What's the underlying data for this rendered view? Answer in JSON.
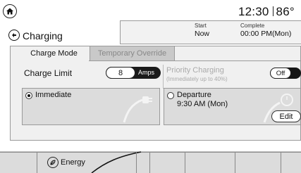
{
  "status": {
    "time": "12:30",
    "temperature": "86°"
  },
  "header": {
    "title": "Charging"
  },
  "times": {
    "start_label": "Start",
    "start_value": "Now",
    "complete_label": "Complete",
    "complete_value": "00:00 PM(Mon)"
  },
  "tabs": [
    {
      "label": "Charge Mode",
      "active": true
    },
    {
      "label": "Temporary Override",
      "active": false
    }
  ],
  "charge_limit": {
    "label": "Charge Limit",
    "value": "8",
    "unit": "Amps"
  },
  "priority": {
    "title": "Priority Charging",
    "subtitle": "(Immediately up to 40%)",
    "toggle_label": "Off",
    "enabled": false
  },
  "options": {
    "immediate": {
      "label": "Immediate",
      "selected": true
    },
    "departure": {
      "label": "Departure",
      "time": "9:30 AM (Mon)",
      "selected": false,
      "edit_label": "Edit"
    }
  },
  "bottom_nav": {
    "energy_label": "Energy"
  },
  "icons": [
    "home-icon",
    "back-arrow-icon",
    "plug-icon",
    "leaf-icon"
  ],
  "colors": {
    "panel_bg": "#f0f0f0",
    "option_bg": "#dcdcdc",
    "toggle_dark": "#151515",
    "inactive_text": "#aaaaaa"
  }
}
